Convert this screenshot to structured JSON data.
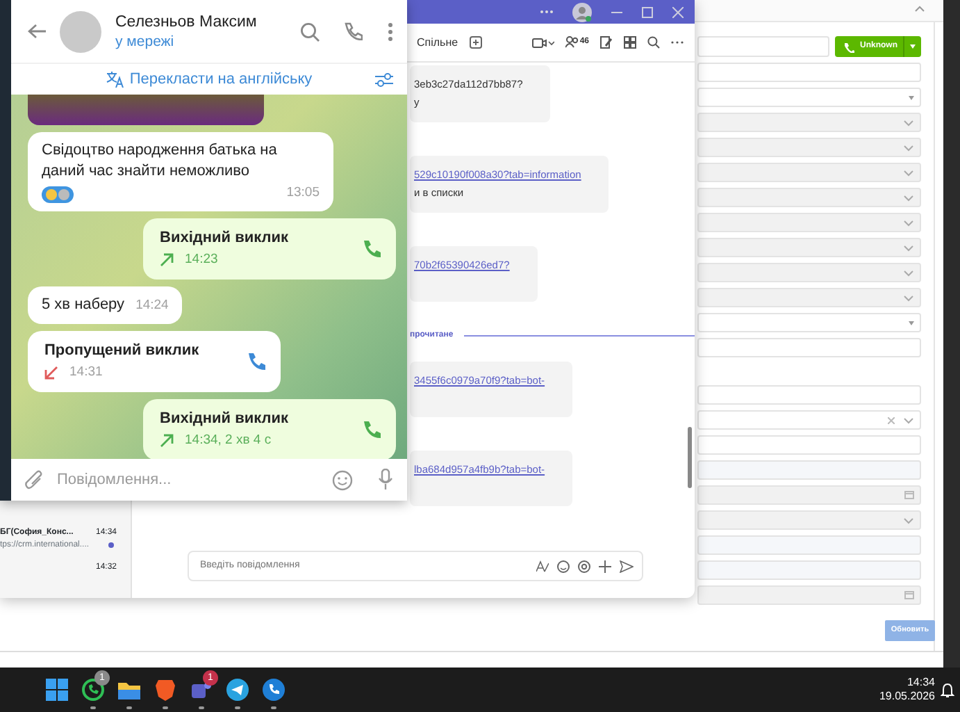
{
  "telegram": {
    "contact": {
      "name": "Селезньов Максим",
      "status": "у мережі"
    },
    "translate": "Перекласти на англійську",
    "messages": [
      {
        "kind": "photo",
        "outgoing": false
      },
      {
        "kind": "text",
        "outgoing": false,
        "text": "Свідоцтво народження батька на даний час знайти неможливо",
        "time": "13:05",
        "reaction": true
      },
      {
        "kind": "call",
        "outgoing": true,
        "title": "Вихідний виклик",
        "time": "14:23",
        "missed": false
      },
      {
        "kind": "text",
        "outgoing": false,
        "text": "5 хв наберу",
        "time": "14:24",
        "reaction": false
      },
      {
        "kind": "call",
        "outgoing": false,
        "title": "Пропущений виклик",
        "time": "14:31",
        "missed": true
      },
      {
        "kind": "call",
        "outgoing": true,
        "title": "Вихідний виклик",
        "time": "14:34, 2 хв 4 с",
        "missed": false
      }
    ],
    "compose": {
      "placeholder": "Повідомлення..."
    }
  },
  "teams": {
    "tab": "Спільне",
    "participants": "46",
    "chats": [
      {
        "title": "БГ(София_Конс...",
        "preview": "tps://crm.international....",
        "time": "14:34",
        "unread": true
      },
      {
        "time": "14:32",
        "unread": false
      }
    ],
    "messages": [
      {
        "kind": "bubble",
        "lines": [
          {
            "text": "3eb3c27da112d7bb87?",
            "link": false
          },
          {
            "text": "у",
            "link": false
          }
        ]
      },
      {
        "kind": "bubble",
        "lines": [
          {
            "text": "529c10190f008a30?tab=information",
            "link": true
          },
          {
            "text": "и в списки",
            "link": false
          }
        ]
      },
      {
        "kind": "bubble",
        "lines": [
          {
            "text": "70b2f65390426ed7?",
            "link": true
          }
        ]
      },
      {
        "kind": "divider",
        "text": "прочитане"
      },
      {
        "kind": "bubble",
        "lines": [
          {
            "text": "3455f6c0979a70f9?tab=bot-",
            "link": true
          }
        ]
      },
      {
        "kind": "bubble",
        "lines": [
          {
            "text": "lba684d957a4fb9b?tab=bot-",
            "link": true
          }
        ]
      }
    ],
    "compose": {
      "placeholder": "Введіть повідомлення"
    }
  },
  "crm": {
    "call_button": "Unknown",
    "update_button": "Обновить",
    "field_groups": [
      [
        {
          "kind": "text"
        },
        {
          "kind": "select"
        },
        {
          "kind": "locked-select"
        },
        {
          "kind": "locked-select"
        },
        {
          "kind": "locked-select"
        },
        {
          "kind": "locked-select"
        },
        {
          "kind": "locked-select"
        },
        {
          "kind": "locked-select"
        },
        {
          "kind": "locked-select"
        },
        {
          "kind": "locked-select"
        },
        {
          "kind": "select"
        },
        {
          "kind": "text"
        }
      ],
      [
        {
          "kind": "text"
        },
        {
          "kind": "clearable-select"
        },
        {
          "kind": "text"
        },
        {
          "kind": "readonly"
        },
        {
          "kind": "locked-date"
        },
        {
          "kind": "locked-select"
        },
        {
          "kind": "readonly"
        },
        {
          "kind": "readonly"
        },
        {
          "kind": "locked-date"
        }
      ]
    ]
  },
  "taskbar": {
    "apps": [
      {
        "kind": "start"
      },
      {
        "kind": "whatsapp",
        "badge": "1",
        "color": "#8a8a8a"
      },
      {
        "kind": "folder"
      },
      {
        "kind": "brave"
      },
      {
        "kind": "teams",
        "badge": "1",
        "color": "#c4314b"
      },
      {
        "kind": "telegram"
      },
      {
        "kind": "phone"
      }
    ],
    "time": "14:34",
    "date": "19.05.2026"
  }
}
